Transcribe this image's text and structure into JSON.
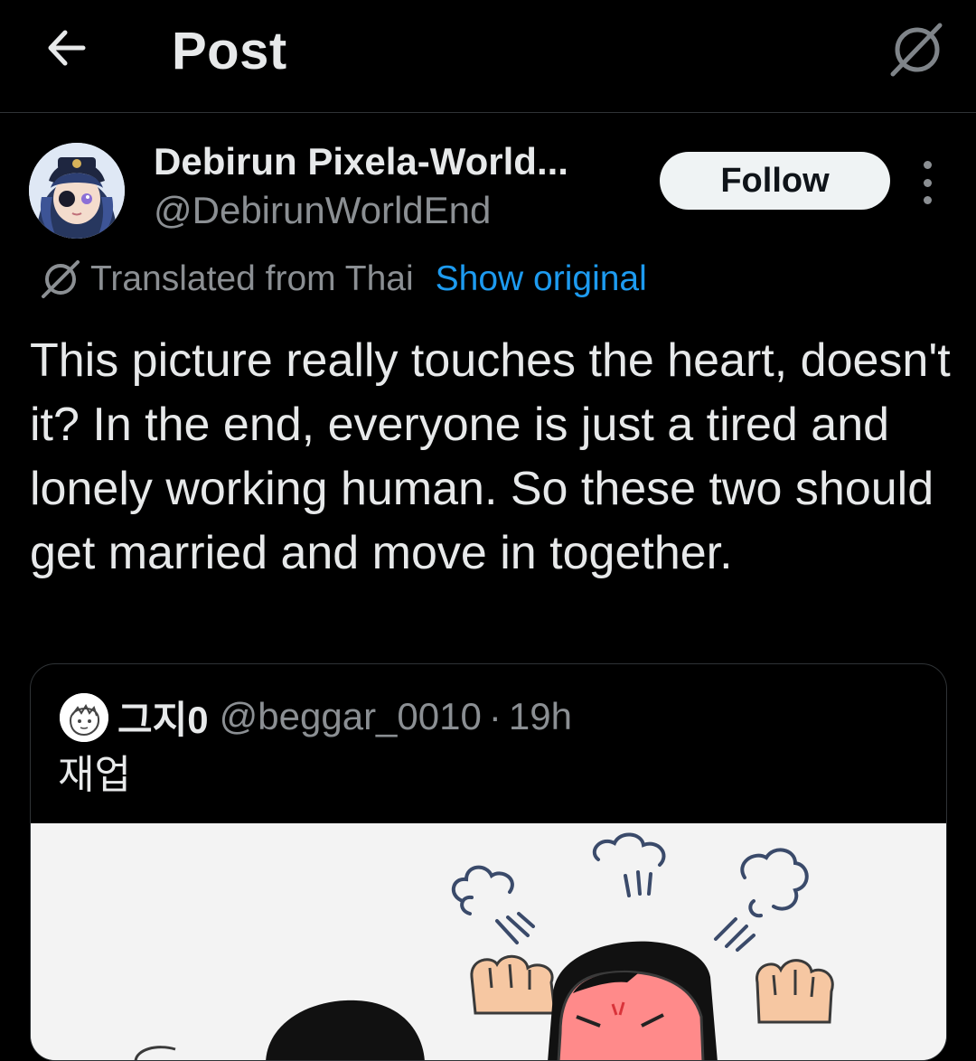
{
  "header": {
    "title": "Post",
    "back_icon": "arrow-left-icon",
    "translate_icon": "translate-icon"
  },
  "post": {
    "author": {
      "display_name": "Debirun Pixela-World...",
      "handle": "@DebirunWorldEnd",
      "avatar_icon": "avatar-anime-character"
    },
    "follow_label": "Follow",
    "more_icon": "more-vertical-icon",
    "translation": {
      "label": "Translated from Thai",
      "show_original": "Show original"
    },
    "text": "This picture really touches the heart, doesn't it? In the end, everyone is just a tired and lonely working human. So these two should get married and move in together.",
    "quote": {
      "display_name": "그지0",
      "handle": "@beggar_0010",
      "separator": "·",
      "time": "19h",
      "text": "재업"
    }
  },
  "colors": {
    "background": "#000000",
    "text_primary": "#e7e9ea",
    "text_secondary": "#8b8f93",
    "link": "#1d9bf0",
    "divider": "#2f3336",
    "follow_bg": "#eff3f4"
  }
}
